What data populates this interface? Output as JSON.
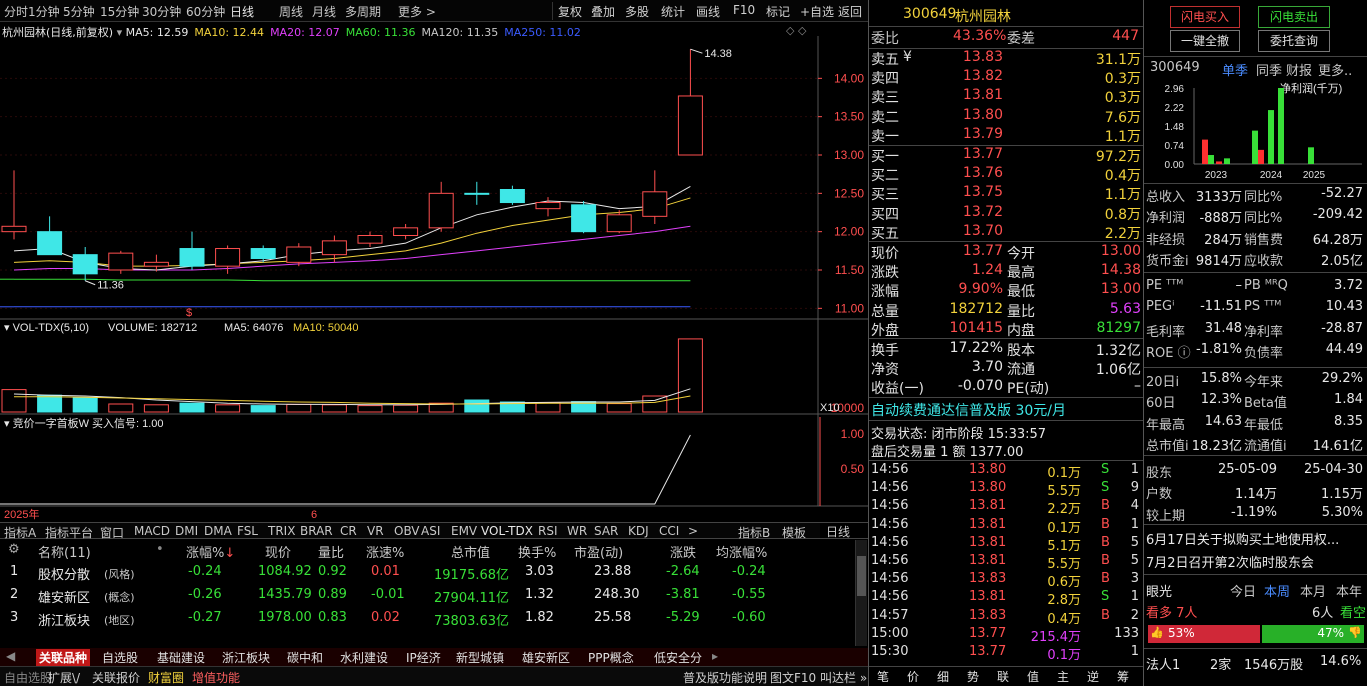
{
  "toolbar": {
    "periods": [
      "分时",
      "1分钟",
      "5分钟",
      "15分钟",
      "30分钟",
      "60分钟",
      "日线",
      "周线",
      "月线",
      "多周期",
      "更多 >"
    ],
    "active_period": "日线",
    "tools": [
      "复权",
      "叠加",
      "多股",
      "统计",
      "画线",
      "F10",
      "标记",
      "+自选",
      "返回"
    ]
  },
  "chart_header": {
    "stock": "杭州园林",
    "mode": "(日线,前复权)",
    "ma": [
      {
        "label": "MA5: 12.59",
        "color": "#e8e8e8"
      },
      {
        "label": "MA10: 12.44",
        "color": "#f2d23c"
      },
      {
        "label": "MA20: 12.07",
        "color": "#e040fb"
      },
      {
        "label": "MA60: 11.36",
        "color": "#38e038"
      },
      {
        "label": "MA120: 11.35",
        "color": "#c8c8c8"
      },
      {
        "label": "MA250: 11.02",
        "color": "#3b5bff"
      }
    ]
  },
  "chart_data": [
    {
      "type": "candlestick",
      "ylim": [
        10.9,
        14.5
      ],
      "yticks": [
        "14.00",
        "13.50",
        "13.00",
        "12.50",
        "12.00",
        "11.50",
        "11.00"
      ],
      "high_label": "14.38",
      "low_label": "11.36",
      "candles": [
        {
          "o": 12.0,
          "h": 12.8,
          "l": 11.9,
          "c": 12.07,
          "up": true
        },
        {
          "o": 12.0,
          "h": 12.2,
          "l": 11.7,
          "c": 11.7,
          "up": false
        },
        {
          "o": 11.7,
          "h": 11.8,
          "l": 11.36,
          "c": 11.45,
          "up": false
        },
        {
          "o": 11.5,
          "h": 11.75,
          "l": 11.45,
          "c": 11.72,
          "up": true
        },
        {
          "o": 11.55,
          "h": 11.7,
          "l": 11.48,
          "c": 11.6,
          "up": true
        },
        {
          "o": 11.78,
          "h": 12.0,
          "l": 11.5,
          "c": 11.55,
          "up": false
        },
        {
          "o": 11.55,
          "h": 11.82,
          "l": 11.45,
          "c": 11.78,
          "up": true
        },
        {
          "o": 11.78,
          "h": 11.82,
          "l": 11.6,
          "c": 11.65,
          "up": false
        },
        {
          "o": 11.6,
          "h": 11.85,
          "l": 11.55,
          "c": 11.8,
          "up": true
        },
        {
          "o": 11.7,
          "h": 11.95,
          "l": 11.6,
          "c": 11.88,
          "up": true
        },
        {
          "o": 11.85,
          "h": 12.0,
          "l": 11.8,
          "c": 11.95,
          "up": true
        },
        {
          "o": 11.95,
          "h": 12.1,
          "l": 11.9,
          "c": 12.05,
          "up": true
        },
        {
          "o": 12.05,
          "h": 12.65,
          "l": 12.0,
          "c": 12.5,
          "up": true
        },
        {
          "o": 12.5,
          "h": 12.65,
          "l": 12.35,
          "c": 12.5,
          "up": false
        },
        {
          "o": 12.55,
          "h": 12.6,
          "l": 12.35,
          "c": 12.38,
          "up": false
        },
        {
          "o": 12.3,
          "h": 12.45,
          "l": 12.2,
          "c": 12.38,
          "up": true
        },
        {
          "o": 12.35,
          "h": 12.4,
          "l": 11.98,
          "c": 12.0,
          "up": false
        },
        {
          "o": 12.0,
          "h": 12.28,
          "l": 11.98,
          "c": 12.22,
          "up": true
        },
        {
          "o": 12.2,
          "h": 12.8,
          "l": 12.1,
          "c": 12.52,
          "up": true
        },
        {
          "o": 13.0,
          "h": 14.38,
          "l": 13.0,
          "c": 13.77,
          "up": true
        }
      ],
      "ma5": [
        11.75,
        11.78,
        11.6,
        11.52,
        11.5,
        11.55,
        11.58,
        11.62,
        11.7,
        11.75,
        11.78,
        11.85,
        12.05,
        12.22,
        12.32,
        12.4,
        12.38,
        12.3,
        12.33,
        12.59
      ],
      "ma10": [
        11.6,
        11.62,
        11.6,
        11.55,
        11.55,
        11.56,
        11.58,
        11.6,
        11.62,
        11.65,
        11.7,
        11.75,
        11.85,
        11.98,
        12.08,
        12.15,
        12.22,
        12.25,
        12.3,
        12.44
      ],
      "ma20": [
        11.5,
        11.52,
        11.52,
        11.5,
        11.5,
        11.5,
        11.52,
        11.55,
        11.58,
        11.6,
        11.62,
        11.65,
        11.7,
        11.75,
        11.8,
        11.85,
        11.9,
        11.95,
        12.0,
        12.07
      ],
      "ma60": [
        11.38,
        11.38,
        11.38,
        11.37,
        11.37,
        11.37,
        11.37,
        11.36,
        11.36,
        11.36,
        11.36,
        11.36,
        11.36,
        11.36,
        11.36,
        11.36,
        11.36,
        11.36,
        11.36,
        11.36
      ],
      "ma250": [
        11.02,
        11.02,
        11.02,
        11.02,
        11.02,
        11.02,
        11.02,
        11.02,
        11.02,
        11.02,
        11.02,
        11.02,
        11.02,
        11.02,
        11.02,
        11.02,
        11.02,
        11.02,
        11.02,
        11.02
      ]
    },
    {
      "type": "bar",
      "title": "VOL-TDX(5,10)",
      "ylabel_tick": "10000",
      "unit": "X10",
      "volume": "VOLUME: 182712",
      "ma5": "MA5: 64076",
      "ma10": "MA10: 50040",
      "values": [
        56000,
        42000,
        35000,
        20000,
        18000,
        22000,
        18000,
        16000,
        19000,
        18000,
        16000,
        17000,
        22000,
        30000,
        25000,
        23000,
        26000,
        21000,
        40000,
        182712
      ],
      "ylim": [
        0,
        190000
      ]
    },
    {
      "type": "line",
      "title": "竞价一字首板W 买入信号: 1.00",
      "yticks": [
        "1.00",
        "0.50"
      ],
      "x_labels": [
        "2025年",
        "6"
      ]
    }
  ],
  "indicator_tabs": [
    "指标A",
    "指标平台",
    "窗口",
    "MACD",
    "DMI",
    "DMA",
    "FSL",
    "TRIX",
    "BRAR",
    "CR",
    "VR",
    "OBV",
    "ASI",
    "EMV",
    "VOL-TDX",
    "RSI",
    "WR",
    "SAR",
    "KDJ",
    "CCI",
    ">",
    "指标B",
    "模板"
  ],
  "period_label": "日线",
  "sector_table": {
    "headers": [
      "名称(11)",
      "涨幅%",
      "现价",
      "量比",
      "涨速%",
      "总市值",
      "换手%",
      "市盈(动)",
      "涨跌",
      "均涨幅%"
    ],
    "rows": [
      {
        "idx": "1",
        "name": "股权分散",
        "tag": "(风格)",
        "pct": "-0.24",
        "price": "1084.92",
        "vr": "0.92",
        "speed": "0.01",
        "cap": "19175.68亿",
        "turn": "3.03",
        "pe": "23.88",
        "chg": "-2.64",
        "avg": "-0.24"
      },
      {
        "idx": "2",
        "name": "雄安新区",
        "tag": "(概念)",
        "pct": "-0.26",
        "price": "1435.79",
        "vr": "0.89",
        "speed": "-0.01",
        "cap": "27904.11亿",
        "turn": "1.32",
        "pe": "248.30",
        "chg": "-3.81",
        "avg": "-0.55"
      },
      {
        "idx": "3",
        "name": "浙江板块",
        "tag": "(地区)",
        "pct": "-0.27",
        "price": "1978.00",
        "vr": "0.83",
        "speed": "0.02",
        "cap": "73803.63亿",
        "turn": "1.82",
        "pe": "25.58",
        "chg": "-5.29",
        "avg": "-0.60"
      }
    ]
  },
  "bottom_tabs": [
    "关联品种",
    "自选股",
    "基础建设",
    "浙江板块",
    "碳中和",
    "水利建设",
    "IP经济",
    "新型城镇",
    "雄安新区",
    "PPP概念",
    "低安全分"
  ],
  "statusbar": {
    "left": [
      "自由选股",
      "扩展\\/",
      "关联报价",
      "财富圈",
      "增值功能"
    ],
    "right": [
      "普及版功能说明",
      "图文F10",
      "叫达栏 »"
    ]
  },
  "quote": {
    "code": "300649",
    "name": "杭州园林",
    "wb": {
      "label": "委比",
      "value": "43.36%",
      "label2": "委差",
      "value2": "447"
    },
    "asks": [
      {
        "label": "卖五",
        "price": "13.83",
        "vol": "31.1万"
      },
      {
        "label": "卖四",
        "price": "13.82",
        "vol": "0.3万"
      },
      {
        "label": "卖三",
        "price": "13.81",
        "vol": "0.3万"
      },
      {
        "label": "卖二",
        "price": "13.80",
        "vol": "7.6万"
      },
      {
        "label": "卖一",
        "price": "13.79",
        "vol": "1.1万"
      }
    ],
    "bids": [
      {
        "label": "买一",
        "price": "13.77",
        "vol": "97.2万"
      },
      {
        "label": "买二",
        "price": "13.76",
        "vol": "0.4万"
      },
      {
        "label": "买三",
        "price": "13.75",
        "vol": "1.1万"
      },
      {
        "label": "买四",
        "price": "13.72",
        "vol": "0.8万"
      },
      {
        "label": "买五",
        "price": "13.70",
        "vol": "2.2万"
      }
    ],
    "stats": [
      {
        "l1": "现价",
        "v1": "13.77",
        "l2": "今开",
        "v2": "13.00"
      },
      {
        "l1": "涨跌",
        "v1": "1.24",
        "l2": "最高",
        "v2": "14.38"
      },
      {
        "l1": "涨幅",
        "v1": "9.90%",
        "l2": "最低",
        "v2": "13.00"
      },
      {
        "l1": "总量",
        "v1": "182712",
        "l2": "量比",
        "v2": "5.63"
      },
      {
        "l1": "外盘",
        "v1": "101415",
        "l2": "内盘",
        "v2": "81297"
      }
    ],
    "stats2": [
      {
        "l1": "换手",
        "v1": "17.22%",
        "l2": "股本",
        "v2": "1.32亿"
      },
      {
        "l1": "净资",
        "v1": "3.70",
        "l2": "流通",
        "v2": "1.06亿"
      },
      {
        "l1": "收益(一)",
        "v1": "-0.070",
        "l2": "PE(动)",
        "v2": "–"
      }
    ],
    "promo": "自动续费通达信普及版  30元/月",
    "trade_status": "交易状态: 闭市阶段 15:33:57",
    "after_hours": "盘后交易量 1 额 1377.00",
    "ticks": [
      {
        "t": "14:56",
        "p": "13.80",
        "v": "0.1万",
        "bs": "S",
        "n": "1"
      },
      {
        "t": "14:56",
        "p": "13.80",
        "v": "5.5万",
        "bs": "S",
        "n": "9"
      },
      {
        "t": "14:56",
        "p": "13.81",
        "v": "2.2万",
        "bs": "B",
        "n": "4"
      },
      {
        "t": "14:56",
        "p": "13.81",
        "v": "0.1万",
        "bs": "B",
        "n": "1"
      },
      {
        "t": "14:56",
        "p": "13.81",
        "v": "5.1万",
        "bs": "B",
        "n": "5"
      },
      {
        "t": "14:56",
        "p": "13.81",
        "v": "5.5万",
        "bs": "B",
        "n": "5"
      },
      {
        "t": "14:56",
        "p": "13.83",
        "v": "0.6万",
        "bs": "B",
        "n": "3"
      },
      {
        "t": "14:56",
        "p": "13.81",
        "v": "2.8万",
        "bs": "S",
        "n": "1"
      },
      {
        "t": "14:57",
        "p": "13.83",
        "v": "0.4万",
        "bs": "B",
        "n": "2"
      },
      {
        "t": "15:00",
        "p": "13.77",
        "v": "215.4万",
        "bs": "",
        "n": "133"
      },
      {
        "t": "15:30",
        "p": "13.77",
        "v": "0.1万",
        "bs": "",
        "n": "1"
      }
    ],
    "bottom_tabs": [
      "笔",
      "价",
      "细",
      "势",
      "联",
      "值",
      "主",
      "逆",
      "筹"
    ]
  },
  "f10": {
    "buttons": [
      "闪电买入",
      "闪电卖出",
      "一键全撤",
      "委托查询"
    ],
    "code": "300649",
    "tabs": [
      "单季",
      "同季",
      "财报",
      "更多.."
    ],
    "mini_chart": {
      "title": "净利润(千万)",
      "yticks": [
        "2.96",
        "2.22",
        "1.48",
        "0.74",
        "0.00"
      ],
      "xticks": [
        "2023",
        "2024",
        "2025"
      ],
      "bars": [
        {
          "v": 0.95,
          "color": "#ff3030"
        },
        {
          "v": 0.35,
          "color": "#38e038"
        },
        {
          "v": 0.1,
          "color": "#ff3030"
        },
        {
          "v": 0.22,
          "color": "#38e038"
        },
        {
          "v": 1.3,
          "color": "#38e038"
        },
        {
          "v": 0.55,
          "color": "#ff3030"
        },
        {
          "v": 2.1,
          "color": "#38e038"
        },
        {
          "v": 2.96,
          "color": "#38e038"
        },
        {
          "v": 0.65,
          "color": "#38e038"
        }
      ]
    },
    "rows1": [
      {
        "l1": "总收入",
        "v1": "3133万",
        "l2": "同比%",
        "v2": "-52.27"
      },
      {
        "l1": "净利润",
        "v1": "-888万",
        "l2": "同比%",
        "v2": "-209.42"
      },
      {
        "l1": "非经损",
        "v1": "284万",
        "l2": "销售费",
        "v2": "64.28万"
      },
      {
        "l1": "货币金i",
        "v1": "9814万",
        "l2": "应收款",
        "v2": "2.05亿"
      }
    ],
    "rows2": [
      {
        "l1": "PE ᵀᵀᴹ",
        "v1": "–",
        "l2": "PB ᴹᴿQ",
        "v2": "3.72"
      },
      {
        "l1": "PEGⁱ",
        "v1": "-11.51",
        "l2": "PS ᵀᵀᴹ",
        "v2": "10.43"
      },
      {
        "l1": "毛利率",
        "v1": "31.48",
        "l2": "净利率",
        "v2": "-28.87"
      },
      {
        "l1": "ROE ⓘ",
        "v1": "-1.81%",
        "l2": "负债率",
        "v2": "44.49"
      }
    ],
    "rows3": [
      {
        "l1": "20日i",
        "v1": "15.8%",
        "l2": "今年来",
        "v2": "29.2%"
      },
      {
        "l1": "60日",
        "v1": "12.3%",
        "l2": "Beta值",
        "v2": "1.84"
      },
      {
        "l1": "年最高",
        "v1": "14.63",
        "l2": "年最低",
        "v2": "8.35"
      },
      {
        "l1": "总市值i",
        "v1": "18.23亿",
        "l2": "流通值i",
        "v2": "14.61亿"
      }
    ],
    "holders": [
      {
        "l": "股东",
        "a": "25-05-09",
        "b": "25-04-30"
      },
      {
        "l": "户数",
        "a": "1.14万",
        "b": "1.15万"
      },
      {
        "l": "较上期",
        "a": "-1.19%",
        "b": "5.30%"
      }
    ],
    "news": [
      "6月17日关于拟购买土地使用权...",
      "7月2日召开第2次临时股东会"
    ],
    "vision": {
      "label": "眼光",
      "tabs": [
        "今日",
        "本周",
        "本月",
        "本年"
      ],
      "bear": "看多 7人",
      "bull": "6人",
      "bull_tag": "看空",
      "bear_pct": "53%",
      "bull_pct": "47%"
    },
    "fund": {
      "l": "法人1",
      "a": "2家",
      "b": "1546万股",
      "c": "14.6%"
    }
  }
}
